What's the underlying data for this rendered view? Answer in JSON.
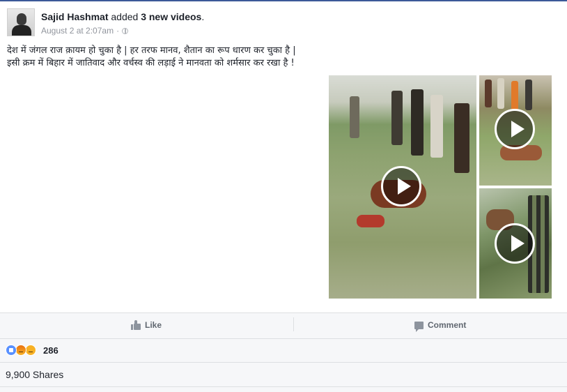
{
  "post": {
    "author": "Sajid Hashmat",
    "verb": "added",
    "count_phrase": "3 new videos",
    "punct": ".",
    "timestamp": "August 2 at 2:07am",
    "separator": "·",
    "privacy_icon": "globe-icon",
    "text_lines": [
      "देश में जंगल राज क़ायम हो चुका है | हर तरफ मानव, शैतान का रूप धारण कर चुका है |",
      "इसी क्रम में बिहार में जातिवाद और वर्चस्व की लड़ाई ने मानवता को शर्मसार कर रखा है !"
    ]
  },
  "videos": [
    {
      "icon": "play-icon"
    },
    {
      "icon": "play-icon"
    },
    {
      "icon": "play-icon"
    }
  ],
  "actions": {
    "like_label": "Like",
    "comment_label": "Comment"
  },
  "reactions": {
    "icons": [
      "like-reaction-icon",
      "angry-reaction-icon",
      "sad-reaction-icon"
    ],
    "count": "286"
  },
  "shares": {
    "label": "9,900 Shares"
  },
  "colors": {
    "brand": "#3b5998",
    "text": "#1d2129",
    "meta_text": "#90949c",
    "action_text": "#606770",
    "bar_background": "#f6f7f9",
    "like_reaction": "#5890ff",
    "angry_reaction": "#e9710f",
    "sad_reaction": "#f7b125"
  }
}
